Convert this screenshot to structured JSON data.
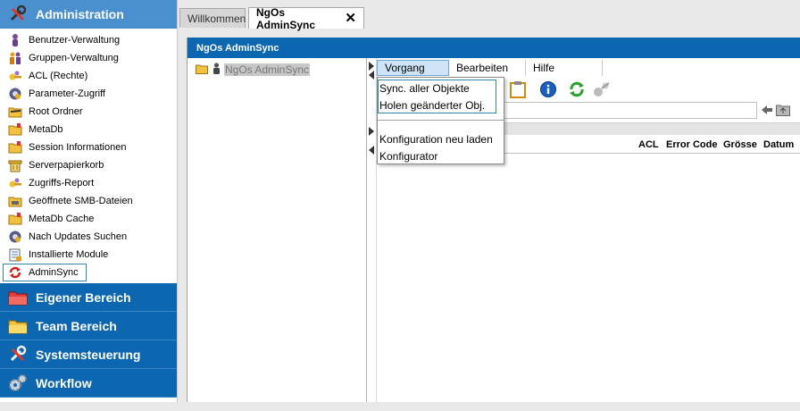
{
  "sidebar": {
    "active_section": "Administration",
    "items": [
      {
        "label": "Benutzer-Verwaltung",
        "icon": "user-admin-icon"
      },
      {
        "label": "Gruppen-Verwaltung",
        "icon": "group-admin-icon"
      },
      {
        "label": "ACL (Rechte)",
        "icon": "acl-keys-icon"
      },
      {
        "label": "Parameter-Zugriff",
        "icon": "parameter-icon"
      },
      {
        "label": "Root Ordner",
        "icon": "root-folder-icon"
      },
      {
        "label": "MetaDb",
        "icon": "metadb-folder-icon"
      },
      {
        "label": "Session Informationen",
        "icon": "session-folder-icon"
      },
      {
        "label": "Serverpapierkorb",
        "icon": "server-trash-icon"
      },
      {
        "label": "Zugriffs-Report",
        "icon": "access-report-icon"
      },
      {
        "label": "Geöffnete SMB-Dateien",
        "icon": "smb-files-icon"
      },
      {
        "label": "MetaDb Cache",
        "icon": "metadb-cache-folder-icon"
      },
      {
        "label": "Nach Updates Suchen",
        "icon": "updates-gear-icon"
      },
      {
        "label": "Installierte Module",
        "icon": "modules-icon"
      },
      {
        "label": "AdminSync",
        "icon": "adminsync-icon",
        "selected": true
      }
    ],
    "sections": [
      {
        "label": "Eigener Bereich",
        "icon": "red-folder-icon"
      },
      {
        "label": "Team Bereich",
        "icon": "yellow-folder-icon"
      },
      {
        "label": "Systemsteuerung",
        "icon": "tools-icon"
      },
      {
        "label": "Workflow",
        "icon": "gears-icon"
      }
    ]
  },
  "tabs": [
    {
      "label": "Willkommen",
      "active": false
    },
    {
      "label": "NgOs AdminSync",
      "active": true
    }
  ],
  "panel": {
    "title": "NgOs AdminSync",
    "tree_root_label": "NgOs AdminSync"
  },
  "menubar": {
    "items": [
      "Vorgang",
      "Bearbeiten",
      "Hilfe"
    ],
    "open_item": "Vorgang"
  },
  "dropdown": {
    "items": [
      "Sync. aller Objekte",
      "Holen geänderter Obj.",
      "Konfiguration neu laden",
      "Konfigurator"
    ]
  },
  "columns": [
    "ACL",
    "Error Code",
    "Grösse",
    "Datum"
  ],
  "colors": {
    "header_blue": "#0d67b0",
    "active_header_blue": "#4a90cf",
    "selection_border": "#2f86a8"
  }
}
